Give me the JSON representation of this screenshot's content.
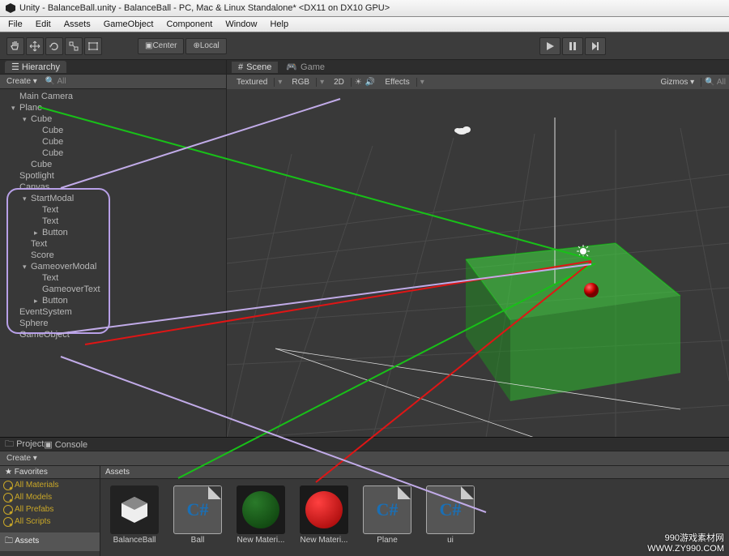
{
  "title": "Unity - BalanceBall.unity - BalanceBall - PC, Mac & Linux Standalone* <DX11 on DX10 GPU>",
  "menu": [
    "File",
    "Edit",
    "Assets",
    "GameObject",
    "Component",
    "Window",
    "Help"
  ],
  "toolbar": {
    "center": "Center",
    "local": "Local"
  },
  "hierarchy": {
    "tab": "Hierarchy",
    "create": "Create ▾",
    "search": "All",
    "items": [
      {
        "t": "Main Camera",
        "i": 0
      },
      {
        "t": "Plane",
        "i": 0,
        "e": "▾"
      },
      {
        "t": "Cube",
        "i": 1,
        "e": "▾"
      },
      {
        "t": "Cube",
        "i": 2
      },
      {
        "t": "Cube",
        "i": 2
      },
      {
        "t": "Cube",
        "i": 2
      },
      {
        "t": "Cube",
        "i": 1
      },
      {
        "t": "Spotlight",
        "i": 0
      },
      {
        "t": "Canvas",
        "i": 0
      },
      {
        "t": "StartModal",
        "i": 1,
        "e": "▾"
      },
      {
        "t": "Text",
        "i": 2
      },
      {
        "t": "Text",
        "i": 2
      },
      {
        "t": "Button",
        "i": 2,
        "e": "▸"
      },
      {
        "t": "Text",
        "i": 1
      },
      {
        "t": "Score",
        "i": 1
      },
      {
        "t": "GameoverModal",
        "i": 1,
        "e": "▾"
      },
      {
        "t": "Text",
        "i": 2
      },
      {
        "t": "GameoverText",
        "i": 2
      },
      {
        "t": "Button",
        "i": 2,
        "e": "▸"
      },
      {
        "t": "EventSystem",
        "i": 0
      },
      {
        "t": "Sphere",
        "i": 0
      },
      {
        "t": "GameObject",
        "i": 0
      }
    ]
  },
  "scene": {
    "tabs": [
      "Scene",
      "Game"
    ],
    "toolbar": {
      "shading": "Textured",
      "render": "RGB",
      "mode2d": "2D",
      "effects": "Effects",
      "gizmos": "Gizmos ▾",
      "search": "All"
    }
  },
  "project": {
    "tabs": [
      "Project",
      "Console"
    ],
    "create": "Create ▾",
    "favorites": "Favorites",
    "favs": [
      "All Materials",
      "All Models",
      "All Prefabs",
      "All Scripts"
    ],
    "assets_hdr": "Assets",
    "assets_folder": "Assets",
    "assets": [
      {
        "name": "BalanceBall",
        "type": "scene"
      },
      {
        "name": "Ball",
        "type": "cs"
      },
      {
        "name": "New Materi...",
        "type": "mat-green"
      },
      {
        "name": "New Materi...",
        "type": "mat-red"
      },
      {
        "name": "Plane",
        "type": "cs"
      },
      {
        "name": "ui",
        "type": "cs"
      }
    ]
  },
  "watermark": {
    "l1": "990游戏素材网",
    "l2": "WWW.ZY990.COM"
  }
}
